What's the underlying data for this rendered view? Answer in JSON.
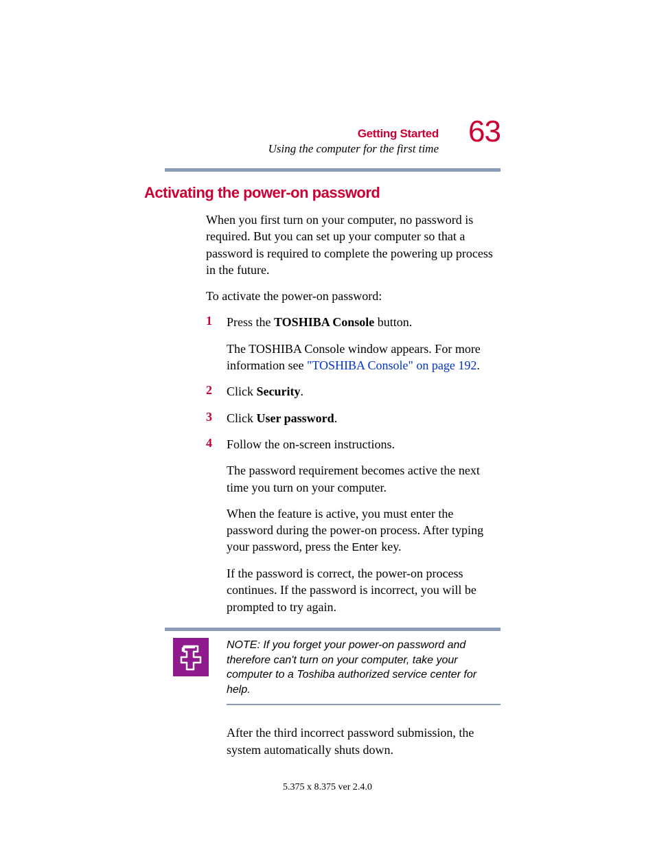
{
  "header": {
    "chapter": "Getting Started",
    "section": "Using the computer for the first time",
    "page_number": "63"
  },
  "heading": "Activating the power-on password",
  "intro": "When you first turn on your computer, no password is required. But you can set up your computer so that a password is required to complete the powering up process in the future.",
  "lead_in": "To activate the power-on password:",
  "steps": {
    "s1": {
      "num": "1",
      "pre": "Press the ",
      "bold": "TOSHIBA Console",
      "post": " button."
    },
    "s1_sub_pre": "The TOSHIBA Console window appears. For more information see ",
    "s1_sub_link": "\"TOSHIBA Console\" on page 192",
    "s1_sub_post": ".",
    "s2": {
      "num": "2",
      "pre": "Click ",
      "bold": "Security",
      "post": "."
    },
    "s3": {
      "num": "3",
      "pre": "Click ",
      "bold": "User password",
      "post": "."
    },
    "s4": {
      "num": "4",
      "text": "Follow the on-screen instructions."
    },
    "s4_sub1": "The password requirement becomes active the next time you turn on your computer.",
    "s4_sub2_pre": "When the feature is active, you must enter the password during the power-on process. After typing your password, press the ",
    "s4_sub2_key": "Enter",
    "s4_sub2_post": " key.",
    "s4_sub3": "If the password is correct, the power-on process continues. If the password is incorrect, you will be prompted to try again."
  },
  "note": "NOTE: If you forget your power-on password and therefore can't turn on your computer, take your computer to a Toshiba authorized service center for help.",
  "after_note": "After the third incorrect password submission, the system automatically shuts down.",
  "footer": "5.375 x 8.375 ver 2.4.0"
}
